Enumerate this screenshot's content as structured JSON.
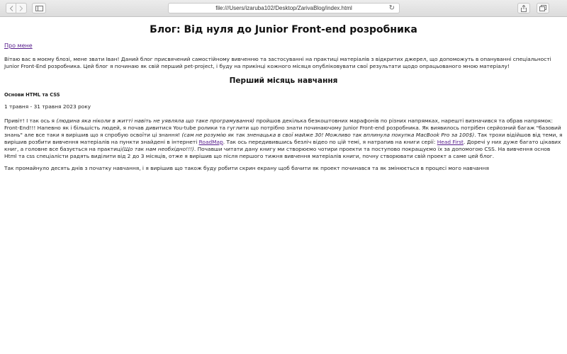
{
  "browser": {
    "url": "file:///Users/izaruba102/Desktop/ZarivaBlog/index.html",
    "icons": [
      "back-icon",
      "forward-icon",
      "sidebar-icon",
      "reload-icon",
      "share-icon",
      "tabs-icon"
    ]
  },
  "page": {
    "title": "Блог: Від нуля до Junior Front-end розробника",
    "about_link": "Про мене",
    "intro": "Вітаю вас в моєму блозі, мене звати Іван! Даний блог присвячений самостійному вивченню та застосуванні на практиці матеріалів з відкритих джерел, що допоможуть в опануванні спеціальності Junior Front-End розробника. Цей блог я починаю як свій перший pet-project, і буду на прикінці кожного місяця опубліковувати свої результати щодо опрацьованого мною матеріалу!",
    "section_title": "Перший місяць навчання",
    "topic": "Основи HTML та CSS",
    "dates": "1 травня - 31 травня 2023 року",
    "story": {
      "t1": "Привіт! І так ось я ",
      "e1": "(людина яка ніколи в житті навіть не уявляла що таке програмування)",
      "t2": " пройшов декілька безкоштовних марафонів по різних напрямках, нарешті визначився та обрав напрямок: Front-End!!! Напевно як і більшість людей, я почав дивитися You-tube ролики та гуглити що потрібно знати починаючому Junior Front-end розробника. Як виявилось потрібен серйозний багаж \"базовий знань\" але все таки я вирішив що я спробую освоїти ці знання! ",
      "e2": "(сам не розумію як так зненацька в свої майже 30! Можливо так вплинула покупка MacBook Pro за 100$)",
      "t3": ". Так трохи відійшов від теми, я вирішив розбити вивчення матеріалів на пункти знайдені в інтернеті ",
      "link1": "RoadMap",
      "t4": ". Так ось передивившись безліч відео по цій темі, я натрапив на книги серії: ",
      "link2": "Head First",
      "t5": ". Доречі у них дуже багато цікавих книг, а головне все базується на практиці",
      "e3": "(Що так нам необхідно!!!)",
      "t6": ". Почавши читати дану книгу ми створюємо чотири проекти та поступово покращуємо їх за допомогою CSS. На вивчення основ Html та css спеціалісти радять виділити від 2 до 3 місяців, отже я вирішив що після першого тижня вивчення матеріалів книги, почну створювати свій проект а саме цей блог."
    },
    "later": "Так промайнуло десять днів з початку навчання, і я вирішив що також буду робити скрин екрану щоб бачити як проект починався та як змінюється в процесі мого навчання"
  }
}
